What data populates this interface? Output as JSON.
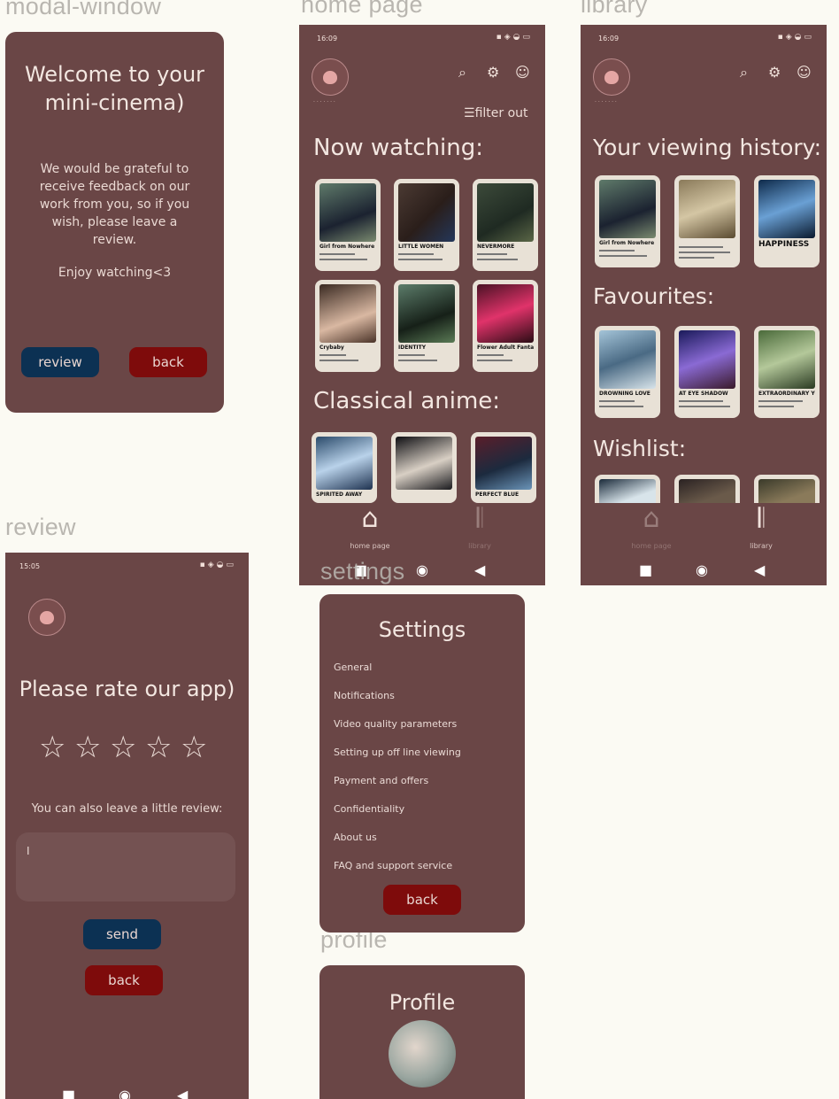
{
  "frames": {
    "modal": "modal-window",
    "home": "home page",
    "library": "library",
    "review": "review",
    "settings": "settings",
    "profile": "profile"
  },
  "status": {
    "time_a": "16:09",
    "time_b": "16:09",
    "time_c": "15:05",
    "icons": "▪◈◒▭"
  },
  "modal": {
    "title": "Welcome to your mini-cinema)",
    "body": "We would be grateful to receive feedback on our work from you, so if you wish, please leave a review.",
    "enjoy": "Enjoy watching<3",
    "review_btn": "review",
    "back_btn": "back"
  },
  "home": {
    "filter": "filter out",
    "now_watching": "Now watching:",
    "classical": "Classical anime:",
    "posters": [
      "Girl from Nowhere",
      "LITTLE WOMEN",
      "NEVERMORE",
      "Crybaby",
      "IDENTITY",
      "Flower Adult Fantasy"
    ],
    "anime": [
      "SPIRITED AWAY",
      "",
      "PERFECT BLUE"
    ],
    "nav_home": "home page",
    "nav_library": "library"
  },
  "library": {
    "history": "Your viewing history:",
    "favourites": "Favourites:",
    "wishlist": "Wishlist:",
    "history_posters": [
      "Girl from Nowhere",
      "",
      "HAPPINESS"
    ],
    "fav_posters": [
      "DROWNING LOVE",
      "AT EYE SHADOW",
      "EXTRAORDINARY YOU"
    ],
    "nav_home": "home page",
    "nav_library": "library"
  },
  "review": {
    "title": "Please rate our app)",
    "stars": "☆☆☆☆☆",
    "subtitle": "You can also leave a little review:",
    "input_value": "I",
    "send": "send",
    "back": "back"
  },
  "settings": {
    "title": "Settings",
    "items": [
      "General",
      "Notifications",
      "Video quality parameters",
      "Setting up off line viewing",
      "Payment and offers",
      "Confidentiality",
      "About us",
      "FAQ and support service"
    ],
    "back": "back"
  },
  "profile": {
    "title": "Profile"
  },
  "icons": {
    "search": "⌕",
    "settings": "⚙",
    "face": "☺",
    "filter": "☰",
    "home": "⌂",
    "library": "𝄃",
    "square": "■",
    "circle": "◉",
    "triangle": "◀"
  },
  "colors": {
    "panel": "#6a4646",
    "background": "#fbfaf3",
    "button_blue": "#0c3153",
    "button_red": "#7e0b0b"
  }
}
